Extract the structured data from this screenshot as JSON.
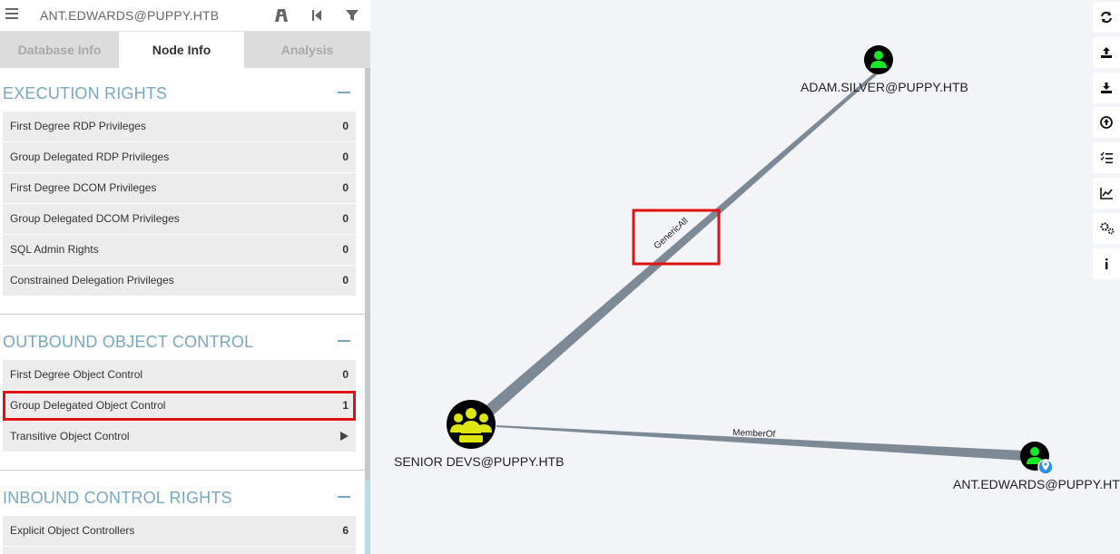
{
  "search": {
    "value": "ANT.EDWARDS@PUPPY.HTB"
  },
  "tabs": [
    {
      "label": "Database Info"
    },
    {
      "label": "Node Info"
    },
    {
      "label": "Analysis"
    }
  ],
  "execution_rights": {
    "title": "EXECUTION RIGHTS",
    "rows": [
      {
        "label": "First Degree RDP Privileges",
        "count": "0"
      },
      {
        "label": "Group Delegated RDP Privileges",
        "count": "0"
      },
      {
        "label": "First Degree DCOM Privileges",
        "count": "0"
      },
      {
        "label": "Group Delegated DCOM Privileges",
        "count": "0"
      },
      {
        "label": "SQL Admin Rights",
        "count": "0"
      },
      {
        "label": "Constrained Delegation Privileges",
        "count": "0"
      }
    ]
  },
  "outbound_control": {
    "title": "OUTBOUND OBJECT CONTROL",
    "rows": [
      {
        "label": "First Degree Object Control",
        "count": "0"
      },
      {
        "label": "Group Delegated Object Control",
        "count": "1"
      },
      {
        "label": "Transitive Object Control",
        "count": ""
      }
    ]
  },
  "inbound_control": {
    "title": "INBOUND CONTROL RIGHTS",
    "rows": [
      {
        "label": "Explicit Object Controllers",
        "count": "6"
      }
    ]
  },
  "graph": {
    "nodes": {
      "adam": {
        "label": "ADAM.SILVER@PUPPY.HTB",
        "kind": "user"
      },
      "group": {
        "label": "SENIOR DEVS@PUPPY.HTB",
        "kind": "group"
      },
      "ant": {
        "label": "ANT.EDWARDS@PUPPY.HTB",
        "kind": "user-owned"
      }
    },
    "edges": {
      "genericall": {
        "label": "GenericAll"
      },
      "memberof": {
        "label": "MemberOf"
      }
    }
  },
  "colors": {
    "accent": "#76a8c0",
    "highlight_border": "#e01111",
    "edge": "#7d8a96",
    "user_icon": "#17e625",
    "group_icon": "#dfe50f",
    "node_bg": "#000000"
  },
  "toolbar_icons": [
    "refresh-icon",
    "upload-icon",
    "download-icon",
    "import-icon",
    "query-list-icon",
    "chart-icon",
    "settings-icon",
    "info-icon"
  ]
}
